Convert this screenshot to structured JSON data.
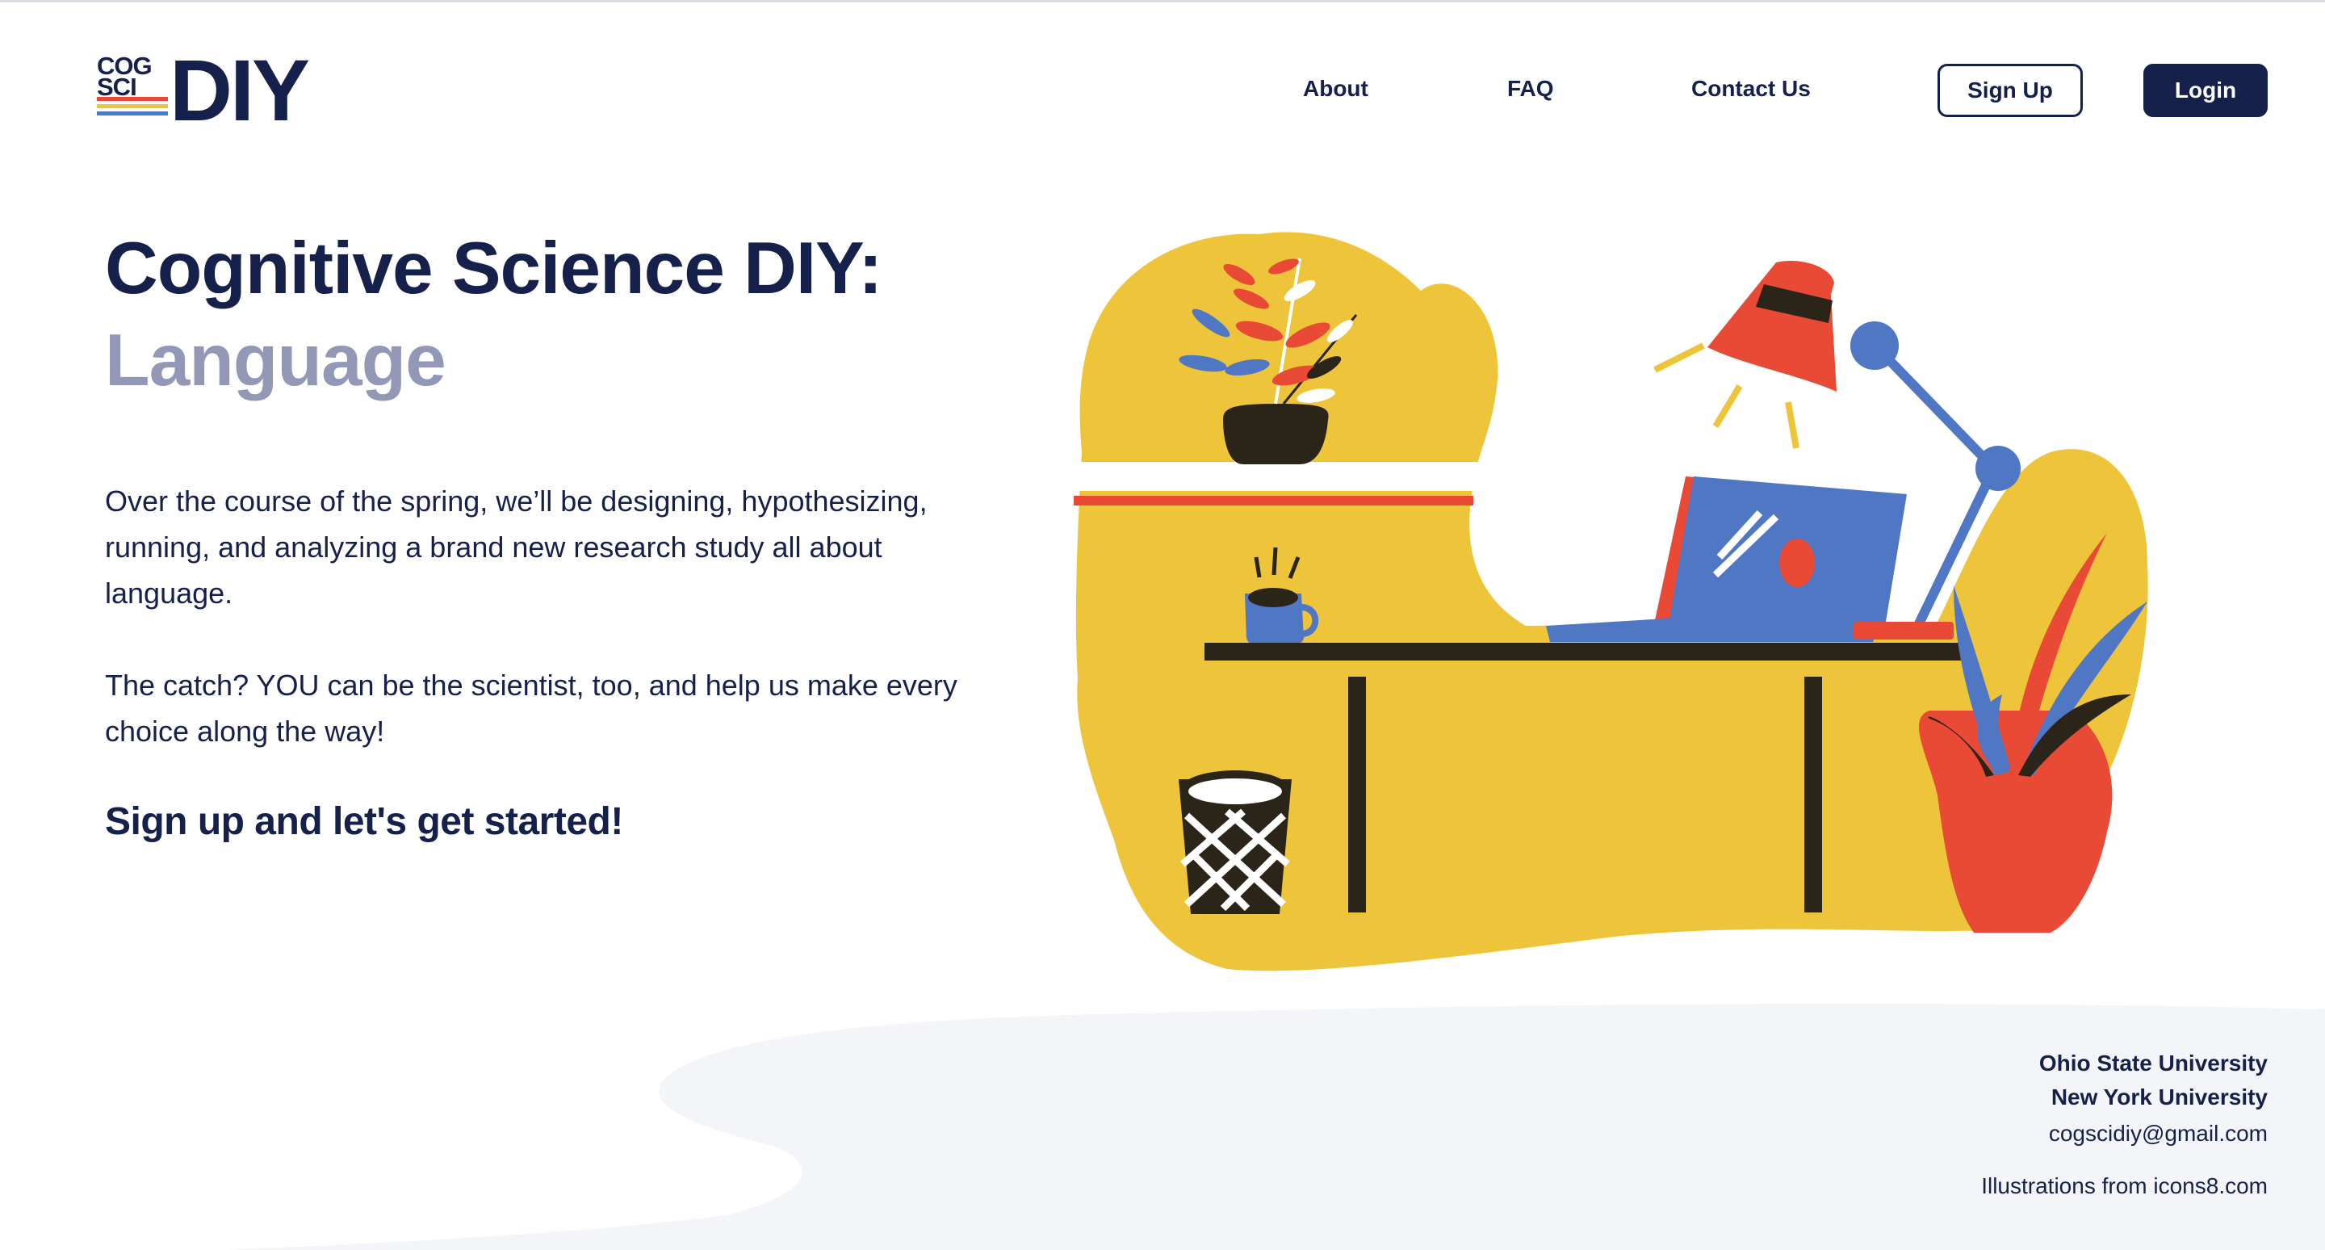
{
  "logo": {
    "line1": "COG",
    "line2": "SCI",
    "mark": "DIY",
    "stripe_colors": [
      "#e84a35",
      "#eec53a",
      "#4f77c3"
    ]
  },
  "nav": {
    "links": [
      {
        "label": "About"
      },
      {
        "label": "FAQ"
      },
      {
        "label": "Contact Us"
      }
    ],
    "signup_label": "Sign Up",
    "login_label": "Login"
  },
  "hero": {
    "title": "Cognitive Science DIY:",
    "subtitle": "Language",
    "paragraph1": "Over the course of the spring, we’ll be designing, hypothesizing, running, and analyzing a brand new research study all about language.",
    "paragraph2": "The catch? YOU can be the scientist, too, and help us make every choice along the way!",
    "cta": "Sign up and let's get started!"
  },
  "illustration": {
    "icons": [
      "plant-icon",
      "lamp-icon",
      "laptop-icon",
      "mug-icon",
      "desk-icon",
      "wastebasket-icon",
      "agave-plant-icon"
    ],
    "colors": {
      "yellow": "#eec53a",
      "red": "#e84a35",
      "blue": "#4f77c3",
      "dark": "#2b2418"
    }
  },
  "footer": {
    "university1": "Ohio State University",
    "university2": "New York University",
    "email": "cogscidiy@gmail.com",
    "credit": "Illustrations from icons8.com"
  },
  "colors": {
    "navy": "#15204b",
    "muted_title": "#9298b6",
    "footer_bg": "#f4f5f9"
  }
}
